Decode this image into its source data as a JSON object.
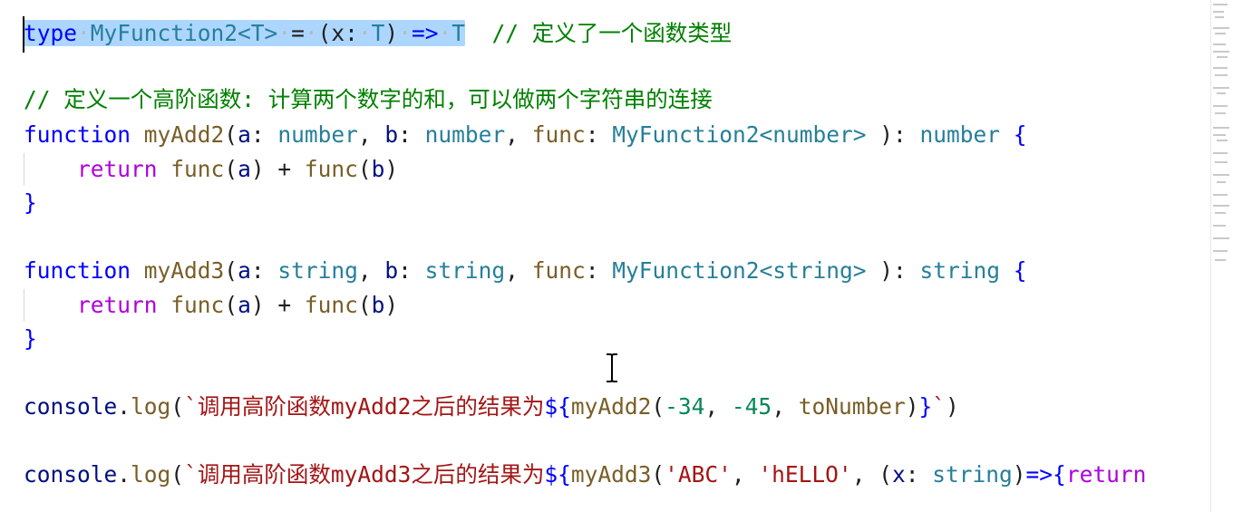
{
  "editor": {
    "line1": {
      "kw": "type",
      "name": "MyFunction2",
      "generic": "<T>",
      "eq": "=",
      "params_open": "(x:",
      "param_type": "T",
      "params_close": ")",
      "arrow": "=>",
      "ret": "T",
      "comment": "// 定义了一个函数类型"
    },
    "line3": {
      "comment": "// 定义一个高阶函数: 计算两个数字的和，可以做两个字符串的连接"
    },
    "line4": {
      "kw": "function",
      "name": "myAdd2",
      "p_open": "(",
      "a": "a",
      "colon1": ": ",
      "t1": "number",
      "comma1": ", ",
      "b": "b",
      "colon2": ": ",
      "t2": "number",
      "comma2": ", ",
      "f": "func",
      "colon3": ": ",
      "t3": "MyFunction2<number>",
      "close": " ): ",
      "ret": "number",
      "brace": " {"
    },
    "line5": {
      "ret": "return",
      "f1": "func",
      "o1": "(",
      "a": "a",
      "c1": ")",
      "plus": " + ",
      "f2": "func",
      "o2": "(",
      "b": "b",
      "c2": ")"
    },
    "line6": {
      "brace": "}"
    },
    "line8": {
      "kw": "function",
      "name": "myAdd3",
      "p_open": "(",
      "a": "a",
      "colon1": ": ",
      "t1": "string",
      "comma1": ", ",
      "b": "b",
      "colon2": ": ",
      "t2": "string",
      "comma2": ", ",
      "f": "func",
      "colon3": ": ",
      "t3": "MyFunction2<string>",
      "close": " ): ",
      "ret": "string",
      "brace": " {"
    },
    "line9": {
      "ret": "return",
      "f1": "func",
      "o1": "(",
      "a": "a",
      "c1": ")",
      "plus": " + ",
      "f2": "func",
      "o2": "(",
      "b": "b",
      "c2": ")"
    },
    "line10": {
      "brace": "}"
    },
    "line12": {
      "obj": "console",
      "dot": ".",
      "method": "log",
      "open": "(",
      "tick": "`",
      "text": "调用高阶函数myAdd2之后的结果为",
      "interp_open": "${",
      "call": "myAdd2",
      "args_open": "(",
      "n1": "-34",
      "sep1": ", ",
      "n2": "-45",
      "sep2": ", ",
      "arg3": "toNumber",
      "args_close": ")",
      "interp_close": "}",
      "tick2": "`",
      "close": ")"
    },
    "line14": {
      "obj": "console",
      "dot": ".",
      "method": "log",
      "open": "(",
      "tick": "`",
      "text": "调用高阶函数myAdd3之后的结果为",
      "interp_open": "${",
      "call": "myAdd3",
      "args_open": "(",
      "s1": "'ABC'",
      "sep1": ", ",
      "s2": "'hELLO'",
      "sep2": ", ",
      "lam_open": "(",
      "x": "x",
      "colon": ": ",
      "xt": "string",
      "lam_close": ")",
      "arrow": "=>",
      "brace": "{",
      "ret": "return"
    }
  },
  "colors": {
    "keyword": "#0000ff",
    "control": "#af00db",
    "type": "#267f99",
    "function": "#795e26",
    "variable": "#001080",
    "comment": "#008000",
    "string": "#a31515",
    "number": "#098658",
    "selection": "#add6ff"
  }
}
